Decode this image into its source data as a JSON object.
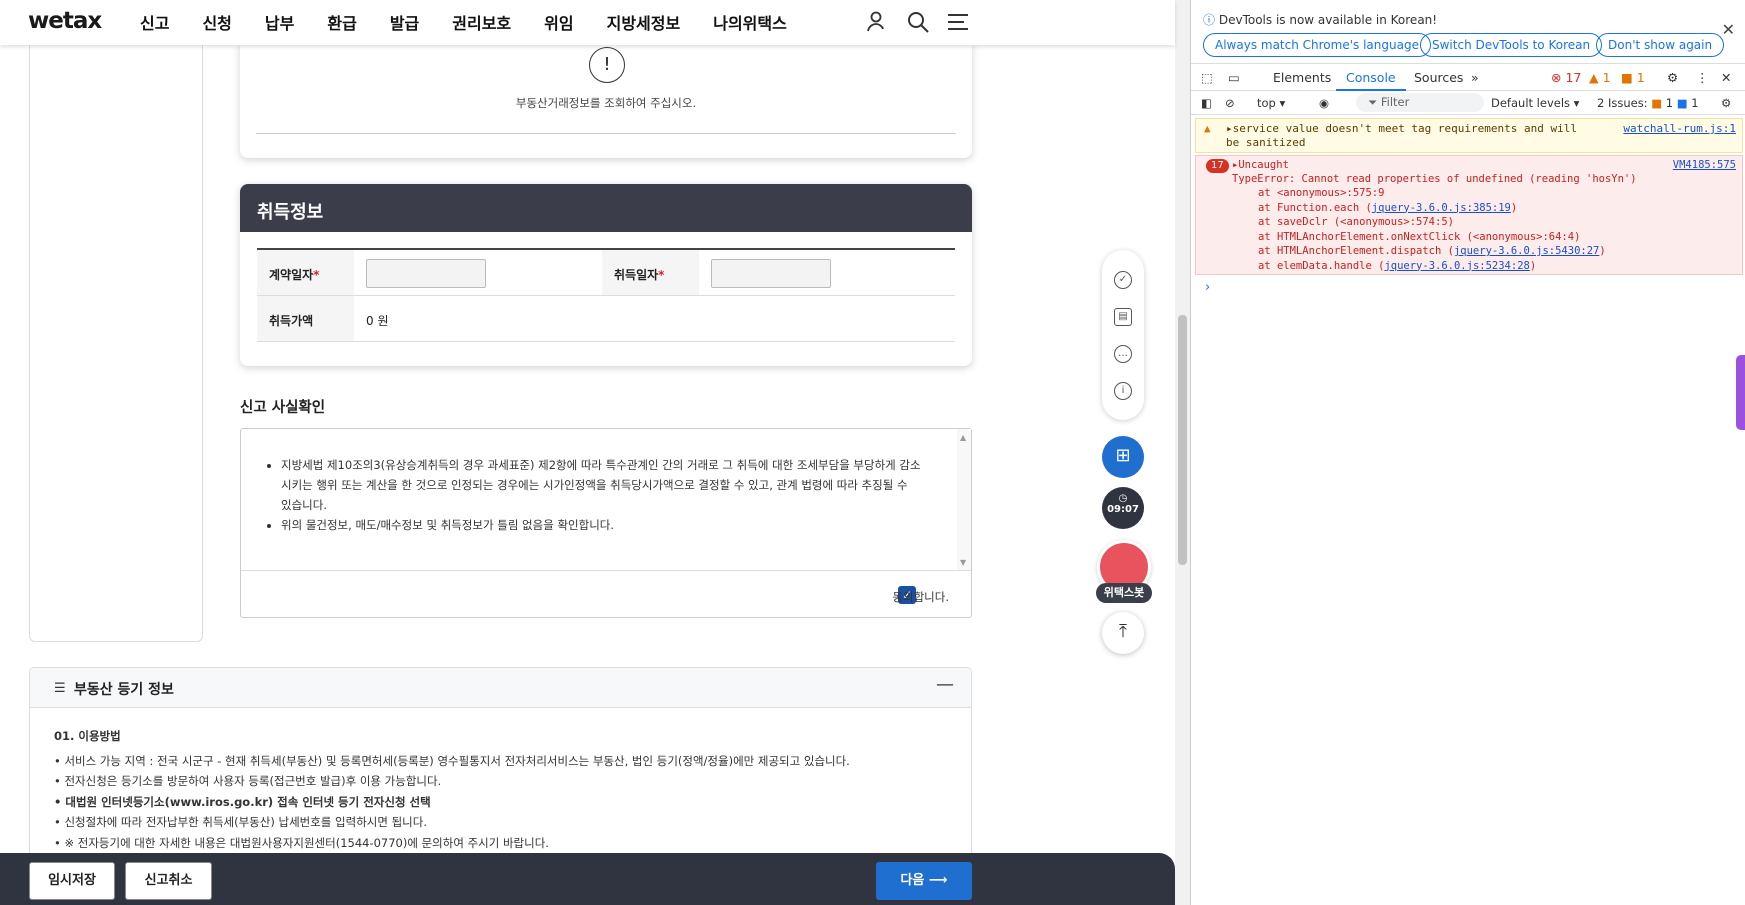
{
  "header": {
    "logo": "wetax",
    "nav": [
      "신고",
      "신청",
      "납부",
      "환급",
      "발급",
      "권리보호",
      "위임",
      "지방세정보",
      "나의위택스"
    ],
    "icons": [
      "my-page-icon",
      "search-icon",
      "menu-icon"
    ]
  },
  "notice": {
    "icon_symbol": "!",
    "message": "부동산거래정보를 조회하여 주십시오."
  },
  "acquisition": {
    "title": "취득정보",
    "contract_date_label": "계약일자",
    "acquire_date_label": "취득일자",
    "price_label": "취득가액",
    "price_value": "0 원",
    "required_mark": "*"
  },
  "confirm": {
    "title": "신고 사실확인",
    "bullets": [
      "지방세법 제10조의3(유상승계취득의 경우 과세표준) 제2항에 따라 특수관계인 간의 거래로 그 취득에 대한 조세부담을 부당하게 감소시키는 행위 또는 계산을 한 것으로 인정되는 경우에는 시가인정액을 취득당시가액으로 결정할 수 있고, 관계 법령에 따라 추징될 수 있습니다.",
      "위의 물건정보, 매도/매수정보 및 취득정보가 틀림 없음을 확인합니다."
    ],
    "agree_label": "동의합니다.",
    "agreed": true
  },
  "registry": {
    "title": "부동산 등기 정보",
    "section_heading": "01. 이용방법",
    "lines": [
      "서비스 가능 지역 : 전국 시군구 - 현재 취득세(부동산) 및 등록면허세(등록분) 영수필통지서 전자처리서비스는 부동산, 법인 등기(정액/정율)에만 제공되고 있습니다.",
      "전자신청은 등기소를 방문하여 사용자 등록(접근번호 발급)후 이용 가능합니다.",
      "대법원 인터넷등기소(www.iros.go.kr) 접속 인터넷 등기 전자신청 선택",
      "신청절차에 따라 전자납부한 취득세(부동산) 납세번호를 입력하시면 됩니다.",
      "※ 전자등기에 대한 자세한 내용은 대법원사용자지원센터(1544-0770)에 문의하여 주시기 바랍니다."
    ],
    "collapse_symbol": "—"
  },
  "sidebar_tools": {
    "clock": "09:07",
    "bot_label": "위택스봇"
  },
  "footer": {
    "temp_save": "임시저장",
    "cancel": "신고취소",
    "next": "다음 ⟶"
  },
  "devtools": {
    "info": "DevTools is now available in Korean!",
    "btn_match": "Always match Chrome's language",
    "btn_switch": "Switch DevTools to Korean",
    "btn_dont": "Don't show again",
    "tabs": [
      "Elements",
      "Console",
      "Sources"
    ],
    "error_count": "17",
    "warn_count": "1",
    "issue_count": "1",
    "context": "top",
    "filter_placeholder": "Filter",
    "levels": "Default levels",
    "issues_label": "2 Issues:",
    "issues_a": "1",
    "issues_b": "1",
    "warning_text": "service value doesn't meet tag requirements and will be sanitized",
    "warning_link": "watchall-rum.js:1",
    "error_badge": "17",
    "error_head": "Uncaught",
    "error_link": "VM4185:575",
    "error_type": "TypeError: Cannot read properties of undefined (reading 'hosYn')",
    "stack": [
      {
        "pre": "at <anonymous>:575:9",
        "link": ""
      },
      {
        "pre": "at Function.each (",
        "link": "jquery-3.6.0.js:385:19",
        "post": ")"
      },
      {
        "pre": "at saveDclr (<anonymous>:574:5)",
        "link": ""
      },
      {
        "pre": "at HTMLAnchorElement.onNextClick (<anonymous>:64:4)",
        "link": ""
      },
      {
        "pre": "at HTMLAnchorElement.dispatch (",
        "link": "jquery-3.6.0.js:5430:27",
        "post": ")"
      },
      {
        "pre": "at elemData.handle (",
        "link": "jquery-3.6.0.js:5234:28",
        "post": ")"
      }
    ],
    "prompt": "›"
  }
}
